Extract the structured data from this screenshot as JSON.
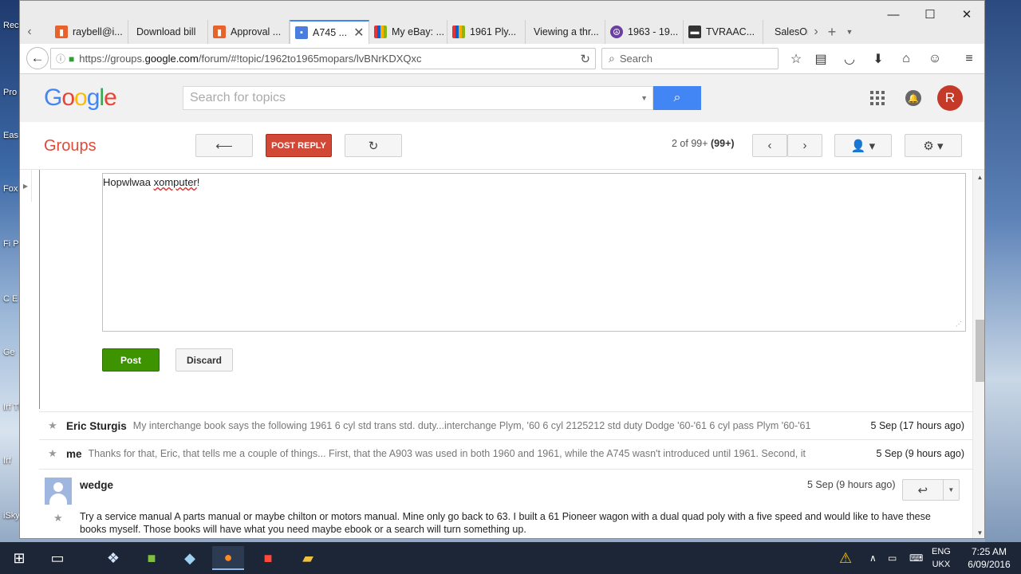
{
  "desktop": {
    "labels": [
      "Rec",
      "Pro",
      "Eas Rec",
      "Fox",
      "Fi P",
      "C E",
      "Ge",
      "Irf Thu",
      "Irf",
      "iSky Re"
    ]
  },
  "browser": {
    "tabs": [
      {
        "label": "raybell@i...",
        "icon": "mail-icon"
      },
      {
        "label": "Download bill",
        "icon": ""
      },
      {
        "label": "Approval ...",
        "icon": "mail-icon"
      },
      {
        "label": "A745 ...",
        "icon": "groups-icon",
        "active": true
      },
      {
        "label": "My eBay: ...",
        "icon": "ebay-icon"
      },
      {
        "label": "1961 Ply...",
        "icon": "ebay-icon"
      },
      {
        "label": "Viewing a thr...",
        "icon": ""
      },
      {
        "label": "1963 - 19...",
        "icon": "peace-icon"
      },
      {
        "label": "TVRAAC...",
        "icon": "car-icon"
      },
      {
        "label": "SalesOr",
        "icon": ""
      }
    ],
    "url_prefix": "https://groups.",
    "url_domain": "google.com",
    "url_rest": "/forum/#!topic/1962to1965mopars/lvBNrKDXQxc",
    "search_placeholder": "Search"
  },
  "google": {
    "logo": "Google",
    "search_placeholder": "Search for topics",
    "avatar_letter": "R"
  },
  "groups": {
    "title": "Groups",
    "post_reply_label": "POST REPLY",
    "pager_text": "2 of 99+",
    "pager_total": "(99+)"
  },
  "reply": {
    "text_prefix": "Hopwlwaa ",
    "text_misspelt": "xomputer",
    "text_suffix": "!",
    "post_label": "Post",
    "discard_label": "Discard"
  },
  "messages": [
    {
      "author": "Eric Sturgis",
      "snippet": "My interchange book says the following 1961 6 cyl std trans std. duty...interchange Plym, '60 6 cyl 2125212 std duty Dodge '60-'61 6 cyl pass Plym '60-'61",
      "date": "5 Sep (17 hours ago)"
    },
    {
      "author": "me",
      "snippet": "Thanks for that, Eric, that tells me a couple of things... First, that the A903 was used in both 1960 and 1961, while the A745 wasn't introduced until 1961. Second, it",
      "date": "5 Sep (9 hours ago)"
    }
  ],
  "expanded_message": {
    "author": "wedge",
    "date": "5 Sep (9 hours ago)",
    "body": "Try a service manual   A parts manual or maybe chilton or motors manual.  Mine only go back to 63. I built a 61 Pioneer wagon with a dual quad poly with a five speed and would like to have these books myself. Those books will have what you need maybe ebook or a search will turn something up."
  },
  "taskbar": {
    "lang_top": "ENG",
    "lang_bottom": "UKX",
    "time": "7:25 AM",
    "date": "6/09/2016"
  },
  "colors": {
    "groups_red": "#dd4b39",
    "post_green": "#3d9400",
    "google_blue": "#4285f4",
    "avatar_red": "#c53929"
  }
}
